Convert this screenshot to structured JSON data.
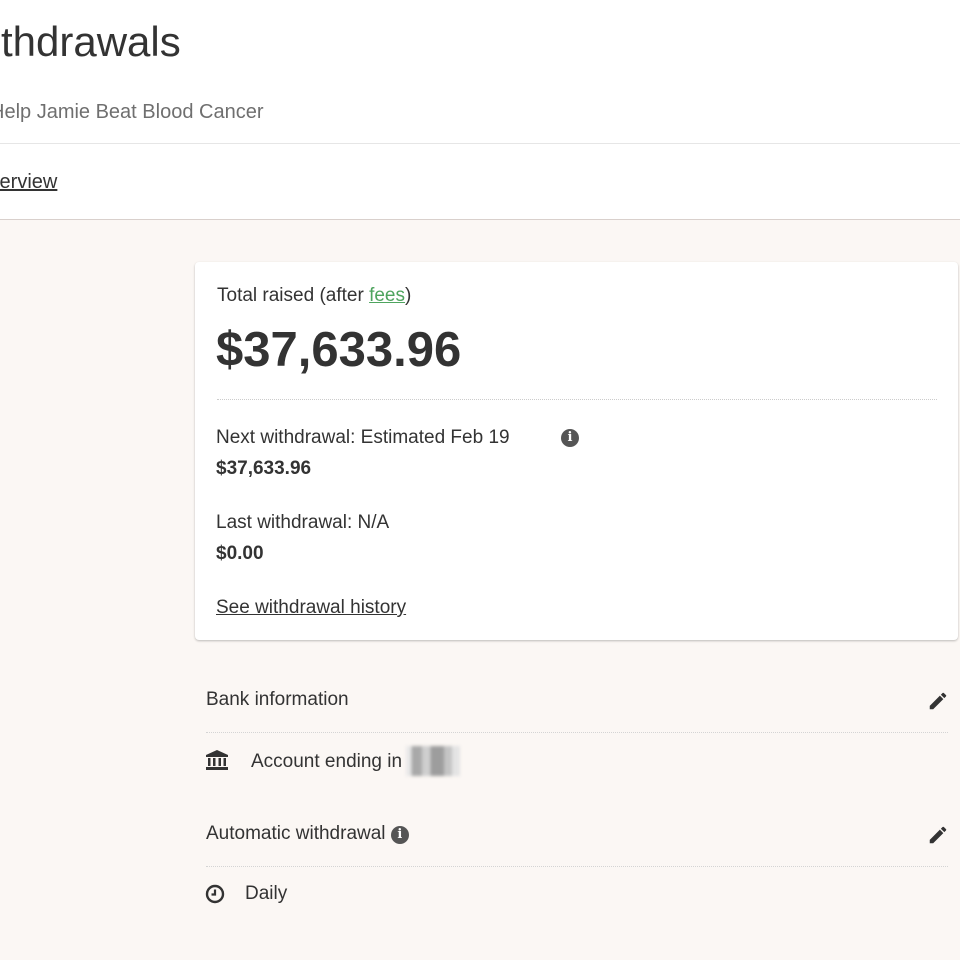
{
  "header": {
    "title": "Withdrawals",
    "fundraiser_name": "Help Jamie Beat Blood Cancer",
    "tab": "Overview"
  },
  "summary": {
    "total_raised_prefix": "Total raised (after ",
    "fees_link": "fees",
    "total_raised_suffix": ")",
    "total_amount": "$37,633.96",
    "next_withdrawal_label": "Next withdrawal: Estimated Feb 19",
    "next_withdrawal_amount": "$37,633.96",
    "last_withdrawal_label": "Last withdrawal: N/A",
    "last_withdrawal_amount": "$0.00",
    "history_link": "See withdrawal history"
  },
  "bank": {
    "heading": "Bank information",
    "account_text": "Account ending in"
  },
  "auto_withdrawal": {
    "heading": "Automatic withdrawal",
    "frequency": "Daily"
  },
  "icons": {
    "info": "info-circle-icon",
    "edit": "pencil-icon",
    "bank": "bank-icon",
    "clock": "clock-icon"
  },
  "colors": {
    "link_green": "#4ea45e",
    "page_background": "#fbf7f4",
    "text": "#333333"
  }
}
